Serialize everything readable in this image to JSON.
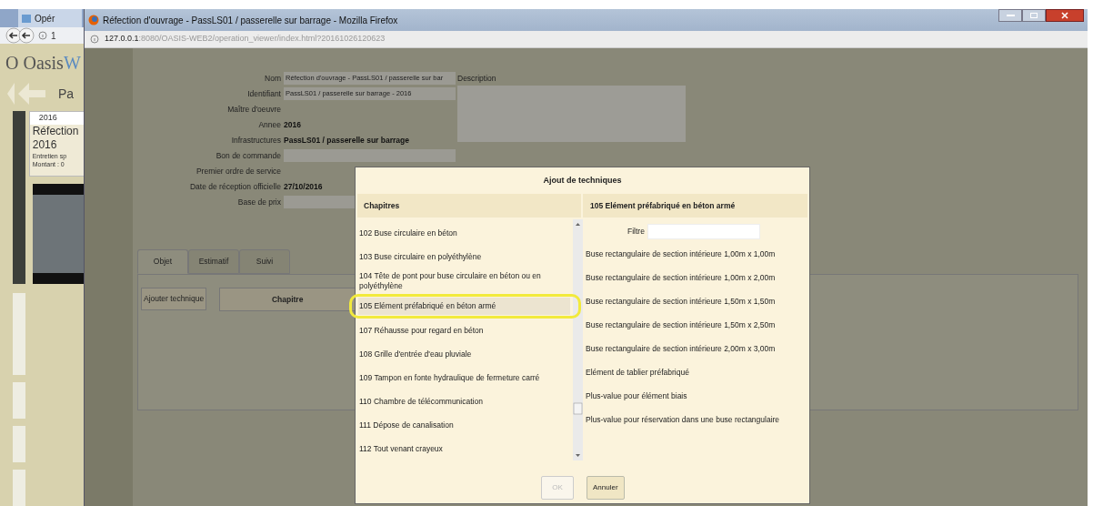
{
  "background_window": {
    "tab": "Opér",
    "url": "1",
    "logo": "O Oasis",
    "logo_suffix": "W",
    "nav_text": "Pa",
    "card": {
      "year": "2016",
      "title_lines": [
        "Réfection",
        "2016"
      ],
      "lines": [
        "Entretien sp",
        "Montant : 0"
      ]
    }
  },
  "window": {
    "title": "Réfection d'ouvrage - PassLS01 / passerelle sur barrage - Mozilla Firefox",
    "url_host": "127.0.0.1",
    "url_rest": ":8080/OASIS-WEB2/operation_viewer/index.html?20161026120623"
  },
  "form": {
    "description_label": "Description",
    "fields": [
      {
        "label": "Nom",
        "kind": "input",
        "value": "Réfection d'ouvrage - PassLS01 / passerelle sur bar"
      },
      {
        "label": "Identifiant",
        "kind": "input",
        "value": "PassLS01 / passerelle sur barrage - 2016"
      },
      {
        "label": "Maître d'oeuvre",
        "kind": "text"
      },
      {
        "label": "Annee",
        "kind": "text",
        "value": "2016"
      },
      {
        "label": "Infrastructures",
        "kind": "text",
        "value": "PassLS01 / passerelle sur barrage"
      },
      {
        "label": "Bon de commande",
        "kind": "input"
      },
      {
        "label": "Premier ordre de service",
        "kind": "text"
      },
      {
        "label": "Date de réception officielle",
        "kind": "text",
        "value": "27/10/2016"
      },
      {
        "label": "Base de prix",
        "kind": "input"
      }
    ]
  },
  "tabs": [
    {
      "label": "Objet",
      "selected": true
    },
    {
      "label": "Estimatif",
      "selected": false
    },
    {
      "label": "Suivi",
      "selected": false
    }
  ],
  "panel": {
    "add_button": "Ajouter technique",
    "column_header": "Chapitre"
  },
  "dialog": {
    "title": "Ajout de techniques",
    "left_header": "Chapitres",
    "right_header": "105 Elément préfabriqué en béton armé",
    "filter_label": "Filtre",
    "chapters": [
      {
        "label": "102 Buse circulaire en béton",
        "selected": false,
        "circled": false
      },
      {
        "label": "103 Buse circulaire en polyéthylène",
        "selected": false,
        "circled": false
      },
      {
        "label": "104 Tête de pont pour buse circulaire en béton ou en polyéthylène",
        "selected": false,
        "circled": false
      },
      {
        "label": "105 Elément préfabriqué en béton armé",
        "selected": true,
        "circled": true
      },
      {
        "label": "107 Réhausse pour regard en béton",
        "selected": false,
        "circled": false
      },
      {
        "label": "108 Grille d'entrée d'eau pluviale",
        "selected": false,
        "circled": false
      },
      {
        "label": "109 Tampon en fonte hydraulique de fermeture carré",
        "selected": false,
        "circled": false
      },
      {
        "label": "110 Chambre de télécommunication",
        "selected": false,
        "circled": false
      },
      {
        "label": "111 Dépose de canalisation",
        "selected": false,
        "circled": false
      },
      {
        "label": "112 Tout venant crayeux",
        "selected": false,
        "circled": false
      }
    ],
    "techniques": [
      "Buse rectangulaire de section intérieure 1,00m x 1,00m",
      "Buse rectangulaire de section intérieure 1,00m x 2,00m",
      "Buse rectangulaire de section intérieure 1,50m x 1,50m",
      "Buse rectangulaire de section intérieure 1,50m x 2,50m",
      "Buse rectangulaire de section intérieure 2,00m x 3,00m",
      "Elément de tablier préfabriqué",
      "Plus-value pour élément biais",
      "Plus-value pour réservation dans une buse rectangulaire"
    ],
    "buttons": [
      {
        "label": "OK",
        "disabled": true
      },
      {
        "label": "Annuler",
        "disabled": false
      }
    ]
  }
}
